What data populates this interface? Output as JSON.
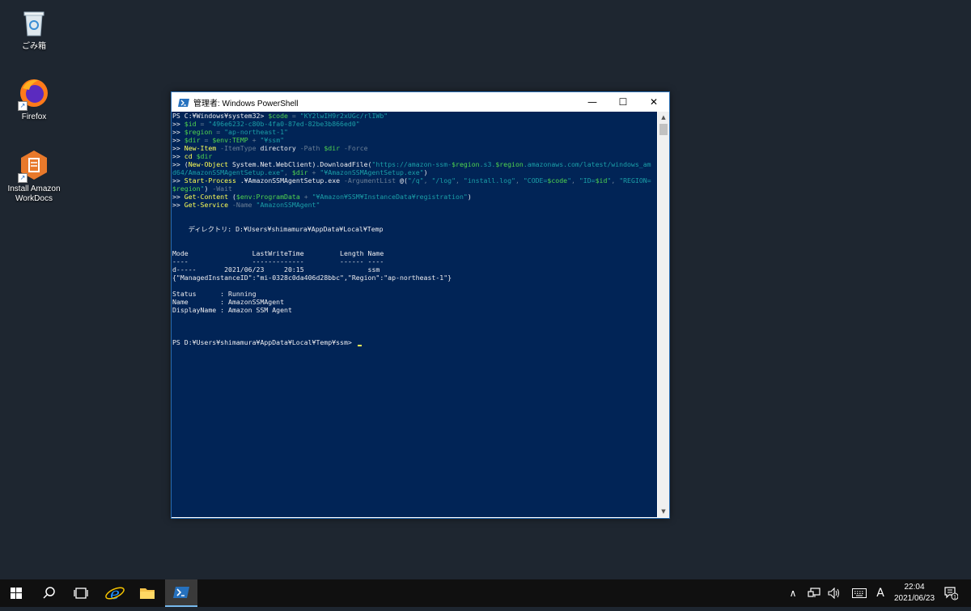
{
  "desktop": {
    "icons": [
      {
        "label": "ごみ箱",
        "icon": "recycle-bin-icon"
      },
      {
        "label": "Firefox",
        "icon": "firefox-icon"
      },
      {
        "label": "Install Amazon\nWorkDocs",
        "icon": "workdocs-icon"
      }
    ]
  },
  "window": {
    "title": "管理者: Windows PowerShell",
    "buttons": {
      "minimize": "—",
      "maximize": "☐",
      "close": "✕"
    }
  },
  "console": {
    "lines": [
      [
        {
          "t": "PS C:¥Windows¥system32> ",
          "c": "w"
        },
        {
          "t": "$code",
          "c": "v"
        },
        {
          "t": " = ",
          "c": "g"
        },
        {
          "t": "\"KY2lwIH9r2xUGc/rlIWb\"",
          "c": "s"
        }
      ],
      [
        {
          "t": ">> ",
          "c": "w"
        },
        {
          "t": "$id",
          "c": "v"
        },
        {
          "t": " = ",
          "c": "g"
        },
        {
          "t": "\"496e6232-c80b-4fa0-87ed-82be3b866ed0\"",
          "c": "s"
        }
      ],
      [
        {
          "t": ">> ",
          "c": "w"
        },
        {
          "t": "$region",
          "c": "v"
        },
        {
          "t": " = ",
          "c": "g"
        },
        {
          "t": "\"ap-northeast-1\"",
          "c": "s"
        }
      ],
      [
        {
          "t": ">> ",
          "c": "w"
        },
        {
          "t": "$dir",
          "c": "v"
        },
        {
          "t": " = ",
          "c": "g"
        },
        {
          "t": "$env:TEMP",
          "c": "v"
        },
        {
          "t": " + ",
          "c": "g"
        },
        {
          "t": "\"¥ssm\"",
          "c": "s"
        }
      ],
      [
        {
          "t": ">> ",
          "c": "w"
        },
        {
          "t": "New-Item",
          "c": "y"
        },
        {
          "t": " -ItemType",
          "c": "g"
        },
        {
          "t": " directory",
          "c": "w"
        },
        {
          "t": " -Path ",
          "c": "g"
        },
        {
          "t": "$dir",
          "c": "v"
        },
        {
          "t": " -Force",
          "c": "g"
        }
      ],
      [
        {
          "t": ">> ",
          "c": "w"
        },
        {
          "t": "cd",
          "c": "y"
        },
        {
          "t": " $dir",
          "c": "v"
        }
      ],
      [
        {
          "t": ">> ",
          "c": "w"
        },
        {
          "t": "(",
          "c": "w"
        },
        {
          "t": "New-Object",
          "c": "y"
        },
        {
          "t": " System.Net.WebClient).DownloadFile(",
          "c": "w"
        },
        {
          "t": "\"https://amazon-ssm-",
          "c": "s"
        },
        {
          "t": "$region",
          "c": "v"
        },
        {
          "t": ".s3.",
          "c": "s"
        },
        {
          "t": "$region",
          "c": "v"
        },
        {
          "t": ".amazonaws.com/latest/windows_am",
          "c": "s"
        }
      ],
      [
        {
          "t": "d64/AmazonSSMAgentSetup.exe\"",
          "c": "s"
        },
        {
          "t": ", ",
          "c": "g"
        },
        {
          "t": "$dir",
          "c": "v"
        },
        {
          "t": " + ",
          "c": "g"
        },
        {
          "t": "\"¥AmazonSSMAgentSetup.exe\"",
          "c": "s"
        },
        {
          "t": ")",
          "c": "w"
        }
      ],
      [
        {
          "t": ">> ",
          "c": "w"
        },
        {
          "t": "Start-Process",
          "c": "y"
        },
        {
          "t": " .¥AmazonSSMAgentSetup.exe",
          "c": "w"
        },
        {
          "t": " -ArgumentList ",
          "c": "g"
        },
        {
          "t": "@(",
          "c": "w"
        },
        {
          "t": "\"/q\"",
          "c": "s"
        },
        {
          "t": ", ",
          "c": "g"
        },
        {
          "t": "\"/log\"",
          "c": "s"
        },
        {
          "t": ", ",
          "c": "g"
        },
        {
          "t": "\"install.log\"",
          "c": "s"
        },
        {
          "t": ", ",
          "c": "g"
        },
        {
          "t": "\"CODE=",
          "c": "s"
        },
        {
          "t": "$code",
          "c": "v"
        },
        {
          "t": "\"",
          "c": "s"
        },
        {
          "t": ", ",
          "c": "g"
        },
        {
          "t": "\"ID=",
          "c": "s"
        },
        {
          "t": "$id",
          "c": "v"
        },
        {
          "t": "\"",
          "c": "s"
        },
        {
          "t": ", ",
          "c": "g"
        },
        {
          "t": "\"REGION=",
          "c": "s"
        }
      ],
      [
        {
          "t": "$region",
          "c": "v"
        },
        {
          "t": "\"",
          "c": "s"
        },
        {
          "t": ") ",
          "c": "w"
        },
        {
          "t": "-Wait",
          "c": "g"
        }
      ],
      [
        {
          "t": ">> ",
          "c": "w"
        },
        {
          "t": "Get-Content",
          "c": "y"
        },
        {
          "t": " (",
          "c": "w"
        },
        {
          "t": "$env:ProgramData",
          "c": "v"
        },
        {
          "t": " + ",
          "c": "g"
        },
        {
          "t": "\"¥Amazon¥SSM¥InstanceData¥registration\"",
          "c": "s"
        },
        {
          "t": ")",
          "c": "w"
        }
      ],
      [
        {
          "t": ">> ",
          "c": "w"
        },
        {
          "t": "Get-Service",
          "c": "y"
        },
        {
          "t": " -Name ",
          "c": "g"
        },
        {
          "t": "\"AmazonSSMAgent\"",
          "c": "s"
        }
      ],
      [],
      [],
      [
        {
          "t": "    ディレクトリ: D:¥Users¥shimamura¥AppData¥Local¥Temp",
          "c": "w"
        }
      ],
      [],
      [],
      [
        {
          "t": "Mode                LastWriteTime         Length Name",
          "c": "w"
        }
      ],
      [
        {
          "t": "----                -------------         ------ ----",
          "c": "w"
        }
      ],
      [
        {
          "t": "d-----       2021/06/23     20:15                ssm",
          "c": "w"
        }
      ],
      [
        {
          "t": "{\"ManagedInstanceID\":\"mi-0328c0da406d28bbc\",\"Region\":\"ap-northeast-1\"}",
          "c": "w"
        }
      ],
      [],
      [
        {
          "t": "Status      : Running",
          "c": "w"
        }
      ],
      [
        {
          "t": "Name        : AmazonSSMAgent",
          "c": "w"
        }
      ],
      [
        {
          "t": "DisplayName : Amazon SSM Agent",
          "c": "w"
        }
      ],
      [],
      [],
      [],
      [
        {
          "t": "PS D:¥Users¥shimamura¥AppData¥Local¥Temp¥ssm> ",
          "c": "w"
        }
      ]
    ]
  },
  "taskbar": {
    "items": [
      "start-icon",
      "search-icon",
      "task-view-icon",
      "internet-explorer-icon",
      "file-explorer-icon",
      "powershell-icon"
    ],
    "active": "powershell-icon",
    "tray": {
      "ime": "A",
      "time": "22:04",
      "date": "2021/06/23",
      "notifications": "1"
    }
  },
  "colors": {
    "console_bg": "#012456",
    "title_border": "#2a6fb5",
    "desktop_bg": "#1e2630",
    "taskbar_bg": "#101010"
  }
}
